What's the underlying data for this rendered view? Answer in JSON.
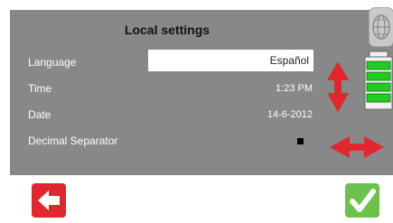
{
  "screen": {
    "title": "Local settings",
    "rows": [
      {
        "label": "Language",
        "value": "Español"
      },
      {
        "label": "Time",
        "value": "1:23 PM"
      },
      {
        "label": "Date",
        "value": "14-6-2012"
      },
      {
        "label": "Decimal Separator",
        "value": ""
      }
    ]
  },
  "icons": {
    "globe": "globe-icon",
    "updown": "up-down-arrow-icon",
    "leftright": "left-right-arrow-icon",
    "battery": "battery-icon",
    "back": "back-arrow-icon",
    "confirm": "checkmark-icon"
  },
  "colors": {
    "panel": "#888888",
    "accent_red": "#e2262e",
    "accent_green": "#6cc24a",
    "battery_green": "#22cc22"
  }
}
